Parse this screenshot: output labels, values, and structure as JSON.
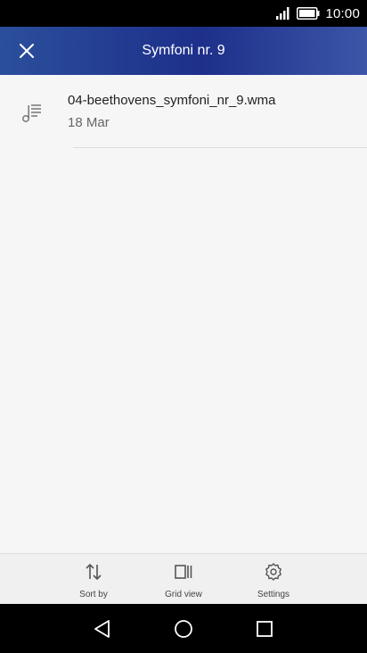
{
  "status_bar": {
    "time": "10:00",
    "signal_icon": "signal-icon",
    "battery_icon": "battery-icon"
  },
  "app_bar": {
    "title": "Symfoni nr. 9",
    "close_icon": "close-icon",
    "colors": {
      "gradient_start": "#2b4f9c",
      "gradient_mid": "#1d2f8a",
      "gradient_end": "#3c56a8"
    }
  },
  "files": [
    {
      "name": "04-beethovens_symfoni_nr_9.wma",
      "date": "18 Mar",
      "icon": "music-playlist-icon"
    }
  ],
  "toolbar": {
    "sort_label": "Sort by",
    "grid_label": "Grid view",
    "settings_label": "Settings"
  },
  "nav_bar": {
    "back_icon": "back-icon",
    "home_icon": "home-icon",
    "recents_icon": "recents-icon"
  }
}
